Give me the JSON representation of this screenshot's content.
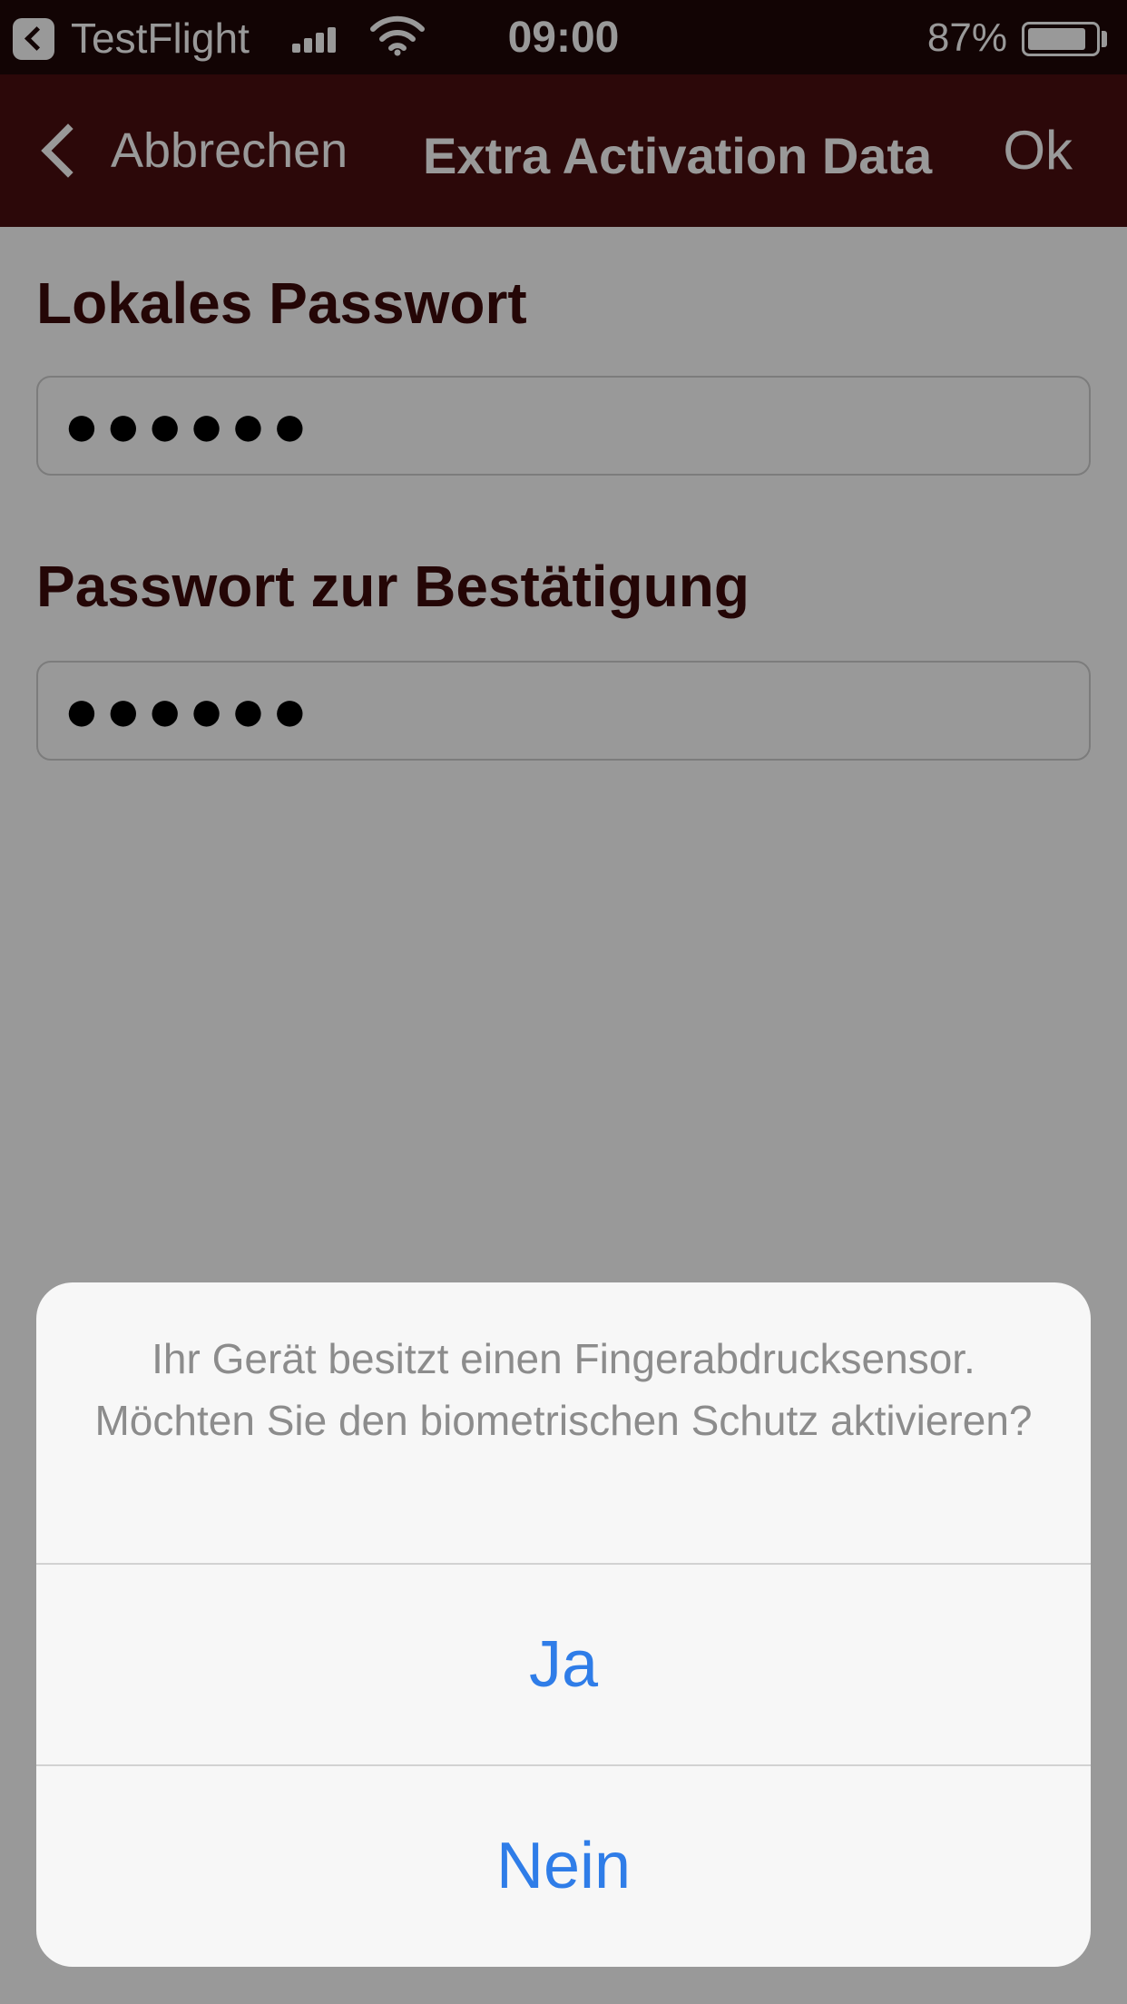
{
  "status_bar": {
    "app_name": "TestFlight",
    "time": "09:00",
    "battery_percent": "87%",
    "battery_level": 0.87,
    "signal_bars_filled": 4,
    "signal_bars_total": 4
  },
  "nav": {
    "back_label": "Abbrechen",
    "title": "Extra Activation Data",
    "ok_label": "Ok"
  },
  "form": {
    "password_label": "Lokales Passwort",
    "password_value": "●●●●●●",
    "confirm_label": "Passwort zur Bestätigung",
    "confirm_value": "●●●●●●"
  },
  "dialog": {
    "message": "Ihr Gerät besitzt einen Fingerabdrucksensor. Möchten Sie den biometrischen Schutz aktivieren?",
    "yes_label": "Ja",
    "no_label": "Nein"
  },
  "colors": {
    "status_bar_bg": "#1e0708",
    "nav_bg": "#4a0e0f",
    "label_text": "#3d0a0b",
    "dialog_button": "#2f7de8"
  },
  "icons": {
    "back": "chevron-left-icon",
    "status_app": "testflight-back-icon",
    "signal": "signal-icon",
    "wifi": "wifi-icon",
    "battery": "battery-icon"
  }
}
